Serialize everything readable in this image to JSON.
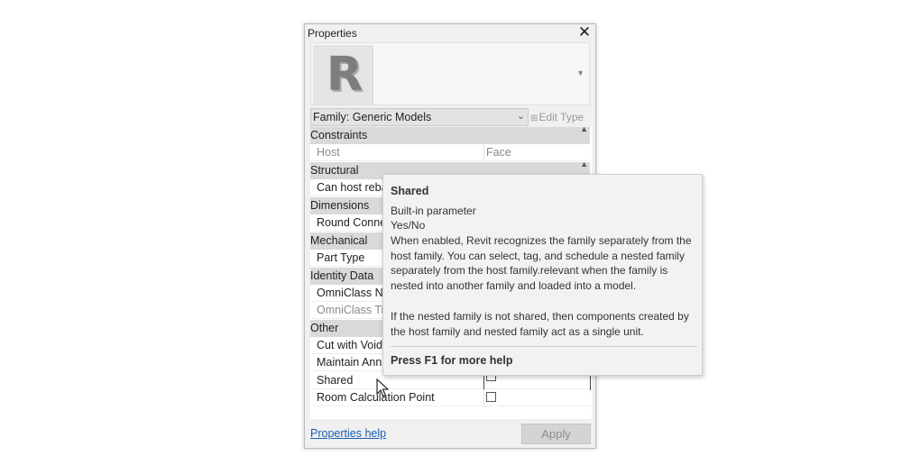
{
  "panel": {
    "title": "Properties",
    "close_icon": "close-icon",
    "preview_letter": "R",
    "type_selector": "Family: Generic Models",
    "edit_type_label": "Edit Type",
    "help_link": "Properties help",
    "apply_label": "Apply"
  },
  "rows": {
    "constraints": "Constraints",
    "host": "Host",
    "host_value": "Face",
    "structural": "Structural",
    "can_host_rebar": "Can host reba",
    "dimensions": "Dimensions",
    "round_connector": "Round Conne",
    "mechanical": "Mechanical",
    "part_type": "Part Type",
    "identity_data": "Identity Data",
    "omniclass_number": "OmniClass Nu",
    "omniclass_title": "OmniClass Tit",
    "other": "Other",
    "cut_with_voids": "Cut with Void",
    "maintain_annotation": "Maintain Ann",
    "shared": "Shared",
    "shared_checked": false,
    "room_calc_point": "Room Calculation Point",
    "room_calc_point_checked": false
  },
  "tooltip": {
    "title": "Shared",
    "line1": "Built-in parameter",
    "line2": "Yes/No",
    "body": "When enabled, Revit recognizes the family separately from the host family. You can select, tag, and schedule a nested family separately from the host family.relevant when the family is nested into another family and loaded into a model.",
    "note": "If the nested family is not shared, then components created by the host family and nested family act as a single unit.",
    "footer": "Press F1 for more help"
  }
}
